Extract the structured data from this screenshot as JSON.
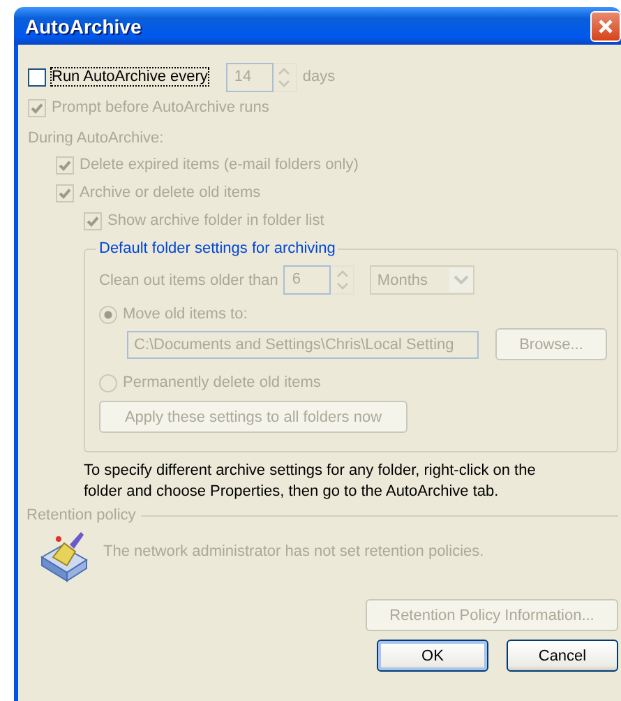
{
  "window": {
    "title": "AutoArchive"
  },
  "run_autoarchive": {
    "label": "Run AutoArchive every",
    "checked": false,
    "disabled": false,
    "value": "14",
    "unit": "days",
    "value_disabled": true
  },
  "prompt": {
    "label": "Prompt before AutoArchive runs",
    "checked": true,
    "disabled": true
  },
  "during_label": "During AutoArchive:",
  "during_options": [
    {
      "label": "Delete expired items (e-mail folders only)",
      "checked": true,
      "disabled": true
    },
    {
      "label": "Archive or delete old items",
      "checked": true,
      "disabled": true,
      "children": [
        {
          "label": "Show archive folder in folder list",
          "checked": true,
          "disabled": true
        }
      ]
    }
  ],
  "default_settings": {
    "title": "Default folder settings for archiving",
    "disabled": true,
    "clean_label": "Clean out items older than",
    "clean_value": "6",
    "clean_unit": "Months",
    "options": [
      {
        "kind": "move",
        "label": "Move old items to:",
        "selected": true,
        "path": "C:\\Documents and Settings\\Chris\\Local Setting",
        "browse_button": "Browse..."
      },
      {
        "kind": "delete",
        "label": "Permanently delete old items",
        "selected": false
      }
    ],
    "apply_button": "Apply these settings to all folders now"
  },
  "note": "To specify different archive settings for any folder, right-click on the folder and choose Properties, then go to the AutoArchive tab.",
  "retention": {
    "title": "Retention policy",
    "message": "The network administrator has not set retention policies.",
    "info_button": "Retention Policy Information...",
    "disabled": true
  },
  "buttons": [
    {
      "label": "OK",
      "default": true
    },
    {
      "label": "Cancel",
      "default": false
    }
  ]
}
